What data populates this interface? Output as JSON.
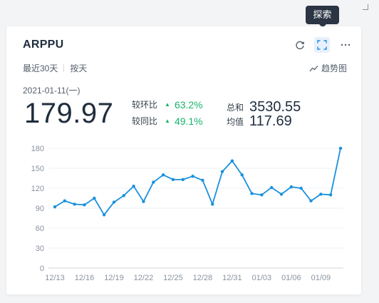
{
  "tooltip": "探索",
  "card": {
    "title": "ARPPU",
    "filters": [
      "最近30天",
      "按天"
    ],
    "trend_label": "趋势图",
    "date": "2021-01-11(一)",
    "value": "179.97",
    "comparisons": [
      {
        "label": "较环比",
        "value": "63.2%"
      },
      {
        "label": "较同比",
        "value": "49.1%"
      }
    ],
    "stats": [
      {
        "label": "总和",
        "value": "3530.55"
      },
      {
        "label": "均值",
        "value": "117.69"
      }
    ],
    "icons": [
      "refresh-icon",
      "fullscreen-icon",
      "more-icon",
      "trend-line-icon"
    ]
  },
  "colors": {
    "accent": "#1a90dd",
    "positive": "#19b36b",
    "tooltip_bg": "#2b3544"
  },
  "chart_data": {
    "type": "line",
    "x": [
      "12/13",
      "12/14",
      "12/15",
      "12/16",
      "12/17",
      "12/18",
      "12/19",
      "12/20",
      "12/21",
      "12/22",
      "12/23",
      "12/24",
      "12/25",
      "12/26",
      "12/27",
      "12/28",
      "12/29",
      "12/30",
      "12/31",
      "01/01",
      "01/02",
      "01/03",
      "01/04",
      "01/05",
      "01/06",
      "01/07",
      "01/08",
      "01/09",
      "01/10",
      "01/11"
    ],
    "series": [
      {
        "values": [
          92,
          101,
          96,
          95,
          105,
          80,
          99,
          109,
          123,
          100,
          129,
          140,
          133,
          133,
          138,
          132,
          96,
          145,
          161,
          140,
          112,
          110,
          121,
          111,
          122,
          120,
          101,
          111,
          110,
          180
        ]
      }
    ],
    "xticks": [
      "12/13",
      "12/16",
      "12/19",
      "12/22",
      "12/25",
      "12/28",
      "12/31",
      "01/03",
      "01/06",
      "01/09"
    ],
    "yticks": [
      0,
      30,
      60,
      90,
      120,
      150,
      180
    ],
    "ylim": [
      0,
      180
    ],
    "grid": true,
    "title": "",
    "xlabel": "",
    "ylabel": ""
  }
}
